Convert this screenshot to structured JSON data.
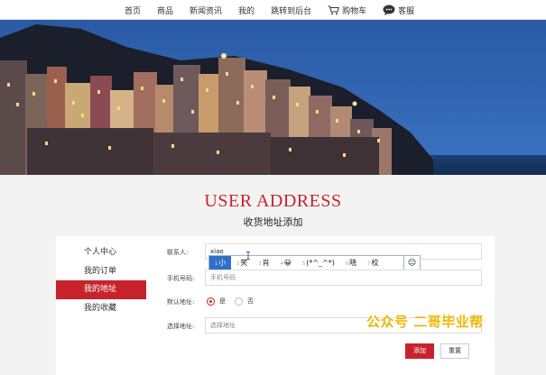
{
  "nav": {
    "items": [
      {
        "label": "首页"
      },
      {
        "label": "商品"
      },
      {
        "label": "新闻资讯"
      },
      {
        "label": "我的"
      },
      {
        "label": "跳转到后台"
      },
      {
        "label": "购物车",
        "icon": "cart-icon"
      },
      {
        "label": "客服",
        "icon": "chat-bubble-icon"
      }
    ]
  },
  "banner": {
    "subject": "hillside-town-at-dusk-photo"
  },
  "section": {
    "title": "USER ADDRESS",
    "subtitle": "收货地址添加"
  },
  "sidebar": {
    "items": [
      {
        "label": "个人中心",
        "active": false
      },
      {
        "label": "我的订单",
        "active": false
      },
      {
        "label": "我的地址",
        "active": true
      },
      {
        "label": "我的收藏",
        "active": false
      }
    ]
  },
  "form": {
    "contact": {
      "label": "联系人:",
      "value": "xiao"
    },
    "ime": {
      "candidates": [
        {
          "num": "1",
          "text": "小"
        },
        {
          "num": "2",
          "text": "笑"
        },
        {
          "num": "3",
          "text": "肖"
        },
        {
          "num": "4",
          "text": "😀"
        },
        {
          "num": "5",
          "text": "(*^_^*)"
        },
        {
          "num": "6",
          "text": "晓"
        },
        {
          "num": "7",
          "text": "校"
        }
      ],
      "emoji_button": "☺"
    },
    "phone": {
      "label": "手机号码:",
      "placeholder": "手机号码"
    },
    "default": {
      "label": "默认地址:",
      "yes": "是",
      "no": "否",
      "selected": "是"
    },
    "address": {
      "label": "选择地址:",
      "placeholder": "选择地址"
    },
    "add_button": "添加",
    "reset_button": "重置"
  },
  "watermark": "公众号 二哥毕业帮",
  "colors": {
    "accent": "#c8232c",
    "sky": "#2b5ea8",
    "watermark": "#f2b705"
  }
}
